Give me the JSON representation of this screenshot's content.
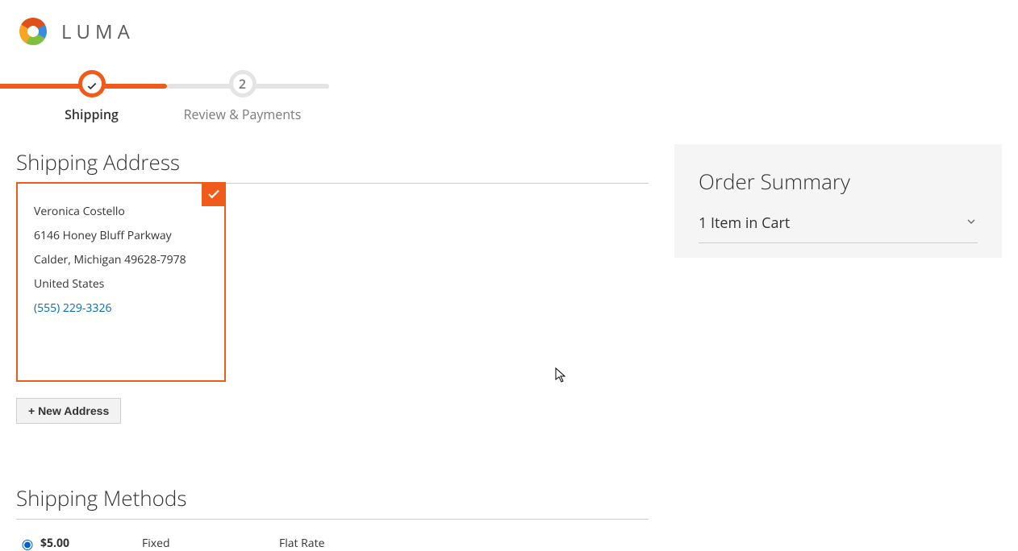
{
  "brand": {
    "name": "LUMA"
  },
  "progress": {
    "steps": [
      {
        "label": "Shipping",
        "state": "active",
        "indicator": "check"
      },
      {
        "label": "Review & Payments",
        "state": "inactive",
        "indicator": "2"
      }
    ]
  },
  "shipping": {
    "title": "Shipping Address",
    "address": {
      "name": "Veronica Costello",
      "street": "6146 Honey Bluff Parkway",
      "city_line": "Calder, Michigan 49628-7978",
      "country": "United States",
      "phone": "(555) 229-3326"
    },
    "new_address_button": "+ New Address"
  },
  "methods": {
    "title": "Shipping Methods",
    "rows": [
      {
        "price": "$5.00",
        "method": "Fixed",
        "carrier": "Flat Rate",
        "selected": true
      }
    ]
  },
  "summary": {
    "title": "Order Summary",
    "cart_line": "1 Item in Cart"
  }
}
